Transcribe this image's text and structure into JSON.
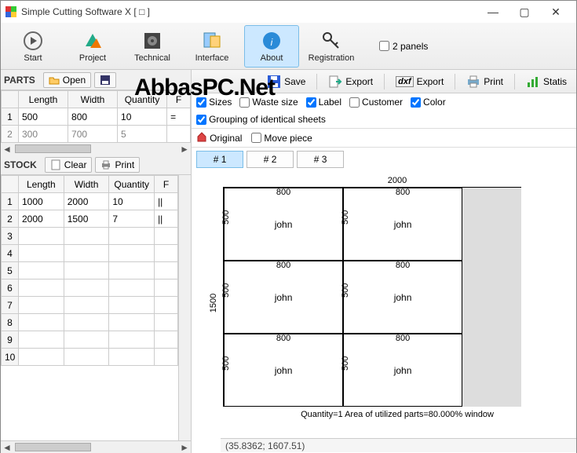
{
  "window": {
    "title": "Simple Cutting Software X [ □ ]"
  },
  "ribbon": {
    "start": "Start",
    "project": "Project",
    "technical": "Technical",
    "interface": "Interface",
    "about": "About",
    "registration": "Registration",
    "panels_label": "2 panels"
  },
  "watermark": "AbbasPC.Net",
  "parts": {
    "title": "PARTS",
    "open": "Open",
    "cols": {
      "length": "Length",
      "width": "Width",
      "quantity": "Quantity",
      "f": "F"
    },
    "rows": [
      {
        "n": "1",
        "length": "500",
        "width": "800",
        "quantity": "10",
        "f": "="
      },
      {
        "n": "2",
        "length": "300",
        "width": "700",
        "quantity": "5",
        "f": ""
      }
    ]
  },
  "stock": {
    "title": "STOCK",
    "clear": "Clear",
    "print": "Print",
    "cols": {
      "length": "Length",
      "width": "Width",
      "quantity": "Quantity",
      "f": "F"
    },
    "rows": [
      {
        "n": "1",
        "length": "1000",
        "width": "2000",
        "quantity": "10",
        "f": "||"
      },
      {
        "n": "2",
        "length": "2000",
        "width": "1500",
        "quantity": "7",
        "f": "||"
      },
      {
        "n": "3",
        "length": "",
        "width": "",
        "quantity": "",
        "f": ""
      },
      {
        "n": "4",
        "length": "",
        "width": "",
        "quantity": "",
        "f": ""
      },
      {
        "n": "5",
        "length": "",
        "width": "",
        "quantity": "",
        "f": ""
      },
      {
        "n": "6",
        "length": "",
        "width": "",
        "quantity": "",
        "f": ""
      },
      {
        "n": "7",
        "length": "",
        "width": "",
        "quantity": "",
        "f": ""
      },
      {
        "n": "8",
        "length": "",
        "width": "",
        "quantity": "",
        "f": ""
      },
      {
        "n": "9",
        "length": "",
        "width": "",
        "quantity": "",
        "f": ""
      },
      {
        "n": "10",
        "length": "",
        "width": "",
        "quantity": "",
        "f": ""
      }
    ]
  },
  "rtoolbar": {
    "save": "Save",
    "export1": "Export",
    "dxf": "dxf",
    "export2": "Export",
    "print": "Print",
    "stats": "Statis"
  },
  "checks": {
    "sizes": "Sizes",
    "waste": "Waste size",
    "label": "Label",
    "customer": "Customer",
    "color": "Color",
    "group": "Grouping of identical sheets",
    "original": "Original",
    "move": "Move piece"
  },
  "tabs": {
    "t1": "# 1",
    "t2": "# 2",
    "t3": "# 3"
  },
  "diagram": {
    "sheet_w": "2000",
    "sheet_h": "1500",
    "piece_w": "800",
    "piece_h": "500",
    "piece_name": "john",
    "summary": "Quantity=1 Area of utilized parts=80.000%  window"
  },
  "status": "(35.8362; 1607.51)"
}
